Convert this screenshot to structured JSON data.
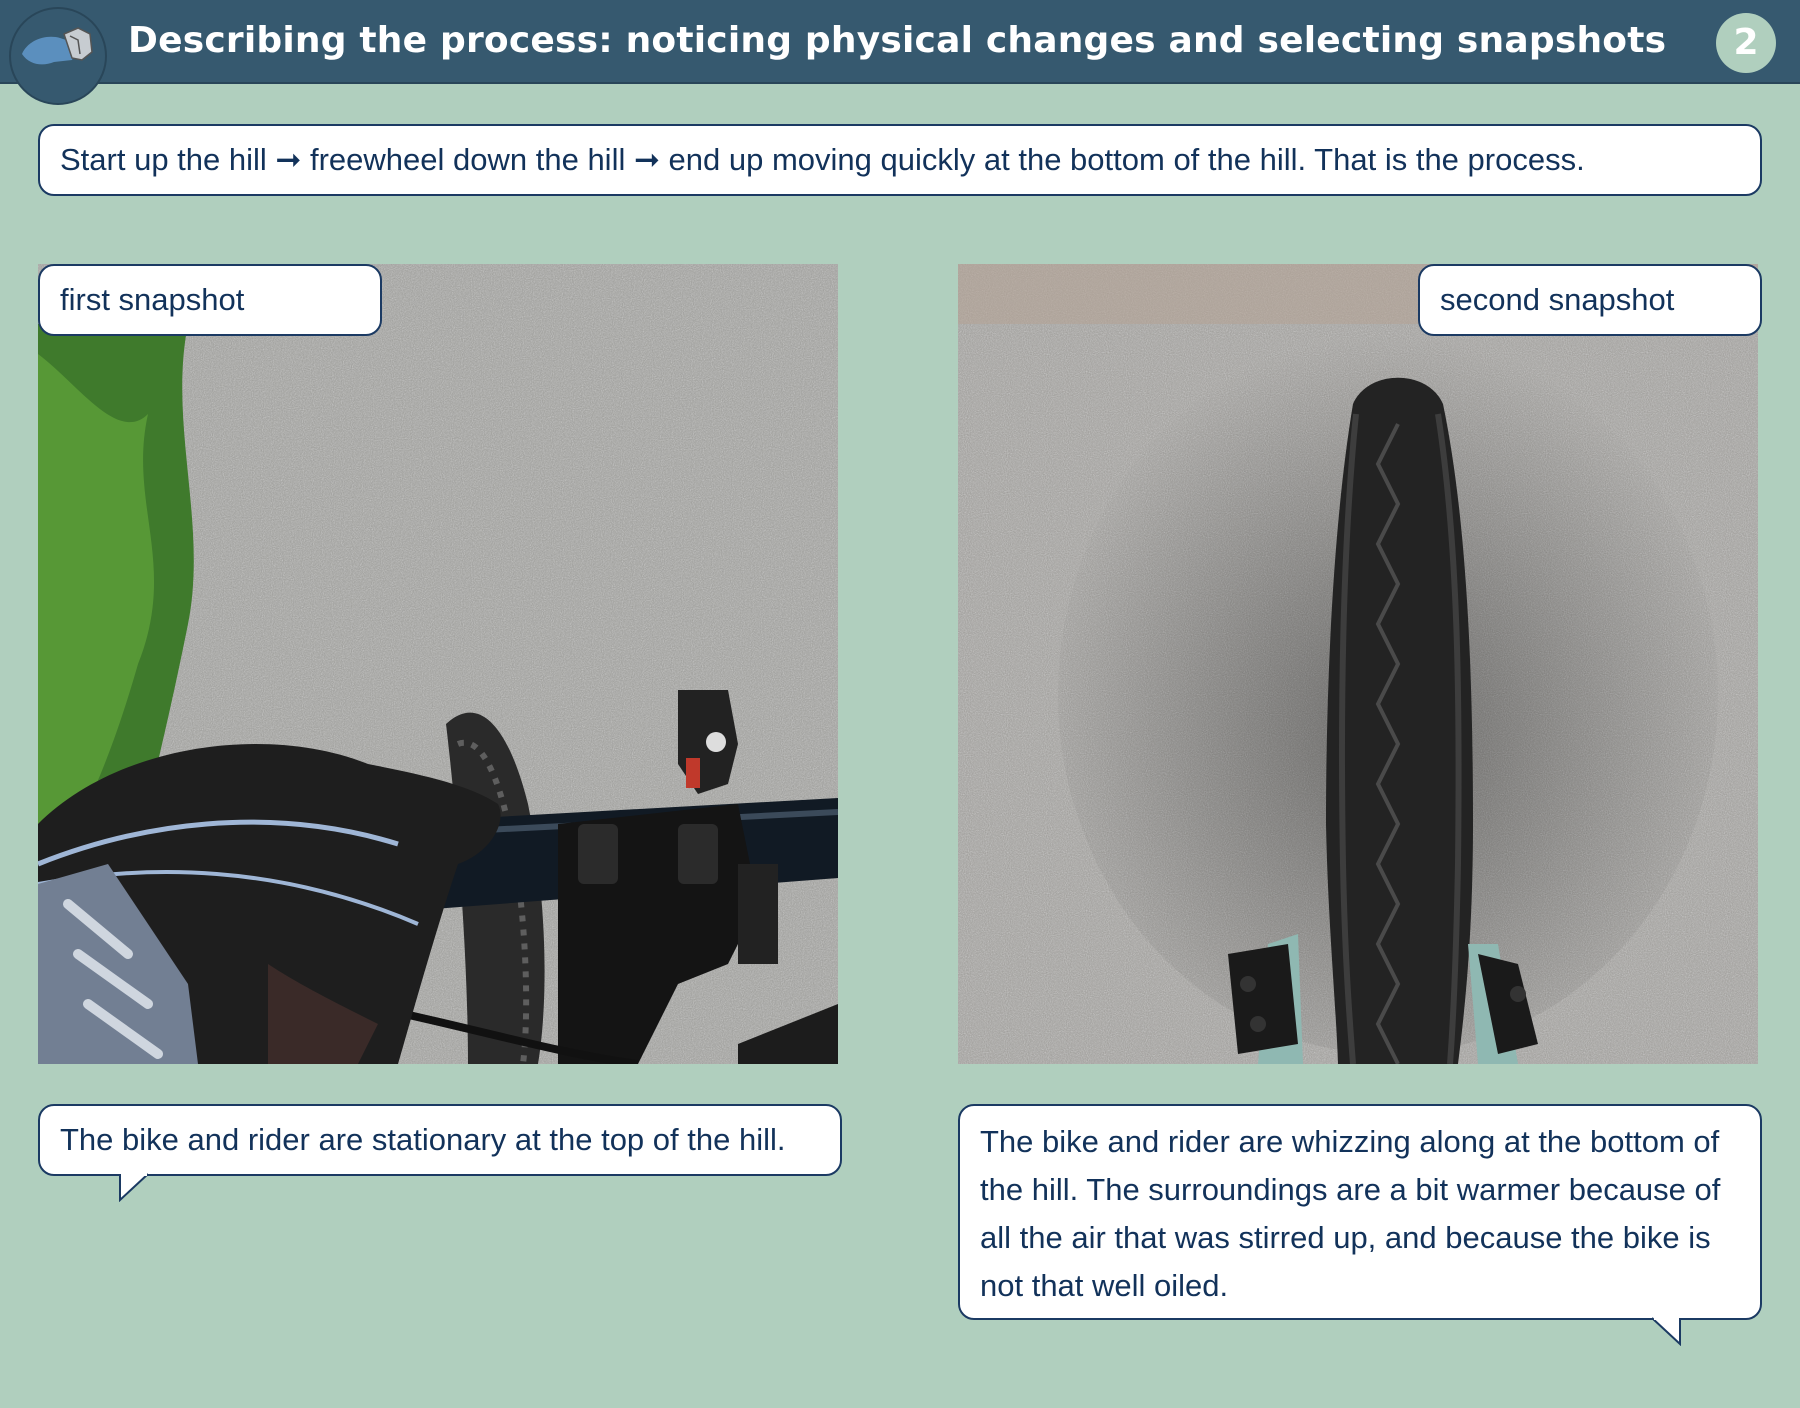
{
  "header": {
    "title": "Describing the process: noticing physical changes and selecting snapshots",
    "page_number": "2",
    "logo_icon": "hand-snapshot-logo-icon"
  },
  "intro": {
    "text": "Start up the hill ➞ freewheel down the hill ➞ end up moving quickly at the bottom of the hill. That is the process."
  },
  "snapshots": [
    {
      "label": "first snapshot",
      "photo": "handlebar-and-gloved-hand-photo",
      "caption": "The bike and rider are stationary at the top of the hill."
    },
    {
      "label": "second snapshot",
      "photo": "front-tyre-on-road-photo",
      "caption": "The bike and rider are whizzing along at the bottom of the hill. The surroundings are a bit warmer because of all the air that was stirred up, and because the bike is not that well oiled."
    }
  ],
  "colors": {
    "background": "#b0cfbe",
    "header": "#36596f",
    "text": "#12325a",
    "border": "#1b3a63"
  }
}
